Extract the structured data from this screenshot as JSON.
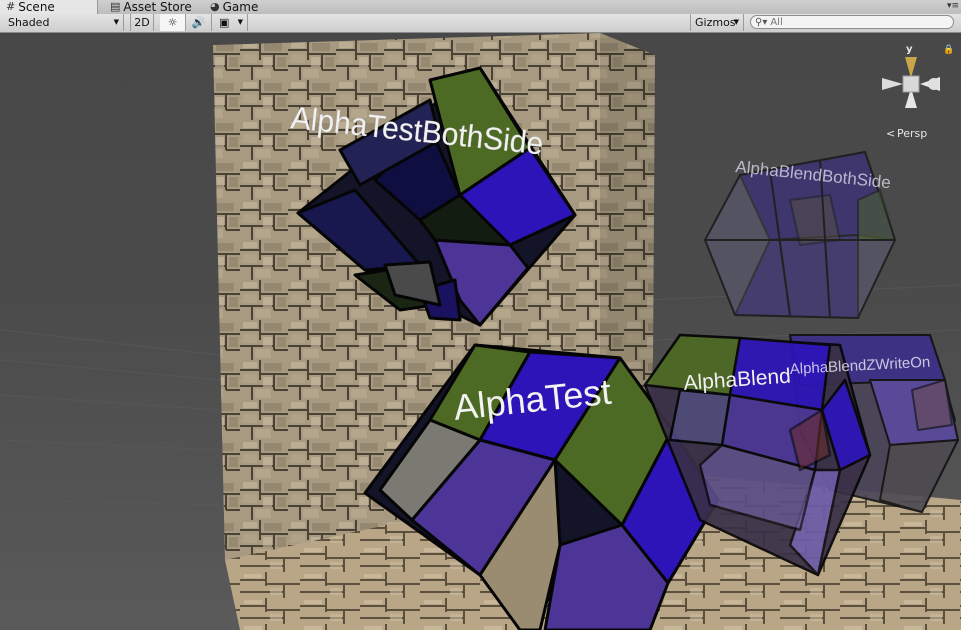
{
  "tabs": [
    {
      "label": "Scene",
      "icon": "grid-icon",
      "active": true
    },
    {
      "label": "Asset Store",
      "icon": "store-icon",
      "active": false
    },
    {
      "label": "Game",
      "icon": "game-icon",
      "active": false
    }
  ],
  "toolbar": {
    "draw_mode": "Shaded",
    "mode_2d": "2D",
    "gizmos_label": "Gizmos",
    "search_placeholder": "All"
  },
  "scene": {
    "labels": {
      "alpha_test_both_side": "AlphaTestBothSide",
      "alpha_test": "AlphaTest",
      "alpha_blend_both_side": "AlphaBlendBothSide",
      "alpha_blend": "AlphaBlend",
      "alpha_blend_zwrite_on": "AlphaBlendZWriteOn"
    },
    "gizmo": {
      "axis_y": "y",
      "projection": "Persp"
    }
  },
  "colors": {
    "olive": "#4d6a24",
    "blue": "#2c14b8",
    "violet": "#4c3596",
    "dark": "#141428"
  }
}
